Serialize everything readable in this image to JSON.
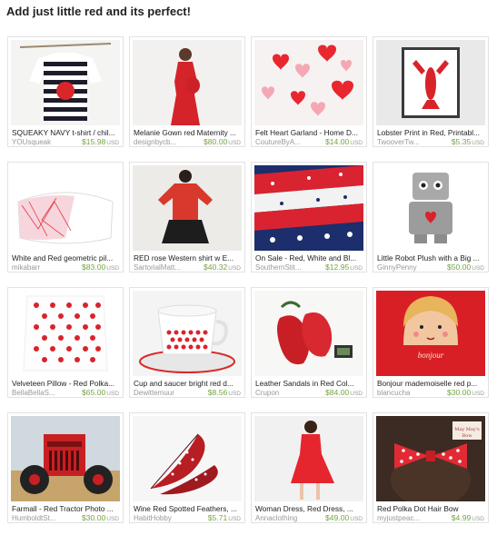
{
  "heading": "Add just little red and its perfect!",
  "colors": {
    "price": "#74a542",
    "shop": "#999999",
    "border": "#e2e2e2"
  },
  "items": [
    {
      "name": "SQUEAKY NAVY t-shirt / chil...",
      "shop": "YOUsqueak",
      "price": "$15.98",
      "currency": "USD",
      "image": "striped-shirt-heart"
    },
    {
      "name": "Melanie Gown red Maternity ...",
      "shop": "designbycb...",
      "price": "$80.00",
      "currency": "USD",
      "image": "red-maternity-gown"
    },
    {
      "name": "Felt Heart Garland - Home D...",
      "shop": "CoutureByA...",
      "price": "$14.00",
      "currency": "USD",
      "image": "heart-garland"
    },
    {
      "name": "Lobster Print in Red, Printabl...",
      "shop": "TwooverTw...",
      "price": "$5.35",
      "currency": "USD",
      "image": "lobster-print"
    },
    {
      "name": "White and Red geometric pil...",
      "shop": "mikabarr",
      "price": "$83.00",
      "currency": "USD",
      "image": "geometric-pillow"
    },
    {
      "name": "RED rose Western shirt w E...",
      "shop": "SartorialMatt...",
      "price": "$40.32",
      "currency": "USD",
      "image": "red-western-shirt"
    },
    {
      "name": "On Sale - Red, White and Bl...",
      "shop": "SouthernStit...",
      "price": "$12.95",
      "currency": "USD",
      "image": "fabric-stack"
    },
    {
      "name": "Little Robot Plush with a Big ...",
      "shop": "GinnyPenny",
      "price": "$50.00",
      "currency": "USD",
      "image": "robot-plush"
    },
    {
      "name": "Velveteen Pillow - Red Polka...",
      "shop": "BellaBellaS...",
      "price": "$65.00",
      "currency": "USD",
      "image": "polka-pillow"
    },
    {
      "name": "Cup and saucer bright red d...",
      "shop": "Dewittemuur",
      "price": "$8.56",
      "currency": "USD",
      "image": "cup-saucer"
    },
    {
      "name": "Leather Sandals in Red Col...",
      "shop": "Crupon",
      "price": "$84.00",
      "currency": "USD",
      "image": "red-sandals"
    },
    {
      "name": "Bonjour mademoiselle red p...",
      "shop": "blancucha",
      "price": "$30.00",
      "currency": "USD",
      "image": "bonjour-print"
    },
    {
      "name": "Farmall - Red Tractor Photo ...",
      "shop": "HumboldtSt...",
      "price": "$30.00",
      "currency": "USD",
      "image": "red-tractor"
    },
    {
      "name": "Wine Red Spotted Feathers, ...",
      "shop": "HabitHobby",
      "price": "$5.71",
      "currency": "USD",
      "image": "spotted-feathers"
    },
    {
      "name": "Woman Dress, Red Dress, ...",
      "shop": "Annaclothing",
      "price": "$49.00",
      "currency": "USD",
      "image": "red-dress"
    },
    {
      "name": "Red Polka Dot Hair Bow",
      "shop": "myjustpeac...",
      "price": "$4.99",
      "currency": "USD",
      "image": "hair-bow"
    }
  ]
}
